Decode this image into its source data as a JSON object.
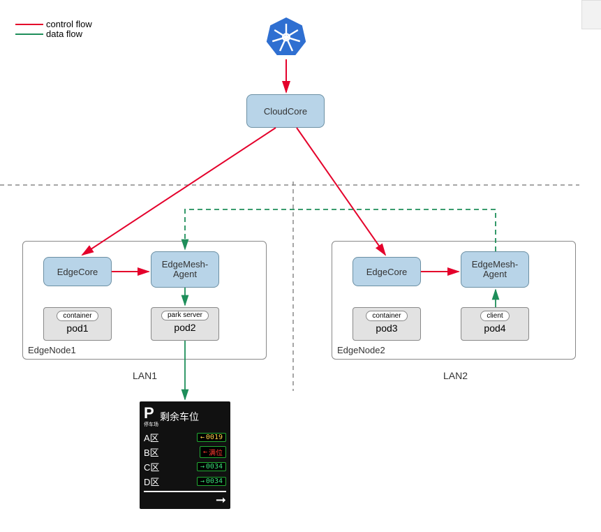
{
  "legend": {
    "control": {
      "label": "control flow",
      "color": "#e4002b"
    },
    "data": {
      "label": "data flow",
      "color": "#1e8e5a"
    }
  },
  "nodes": {
    "cloudcore": "CloudCore",
    "edgecore1": "EdgeCore",
    "edgemesh1": "EdgeMesh-Agent",
    "edgecore2": "EdgeCore",
    "edgemesh2": "EdgeMesh-Agent",
    "pod1": {
      "inner": "container",
      "label": "pod1"
    },
    "pod2": {
      "inner": "park server",
      "label": "pod2"
    },
    "pod3": {
      "inner": "container",
      "label": "pod3"
    },
    "pod4": {
      "inner": "client",
      "label": "pod4"
    }
  },
  "groups": {
    "edgenode1": "EdgeNode1",
    "edgenode2": "EdgeNode2"
  },
  "lans": {
    "lan1": "LAN1",
    "lan2": "LAN2"
  },
  "parking": {
    "p_label": "P",
    "p_sub": "停车场",
    "title": "剩余车位",
    "rows": [
      {
        "zone": "A区",
        "dir": "←",
        "val": "0019",
        "col": "#ffd24a"
      },
      {
        "zone": "B区",
        "dir": "←",
        "val": "满位",
        "col": "#ff3b30"
      },
      {
        "zone": "C区",
        "dir": "→",
        "val": "0034",
        "col": "#3be07a"
      },
      {
        "zone": "D区",
        "dir": "→",
        "val": "0034",
        "col": "#3be07a"
      }
    ]
  },
  "icons": {
    "k8s": "kubernetes-icon"
  }
}
